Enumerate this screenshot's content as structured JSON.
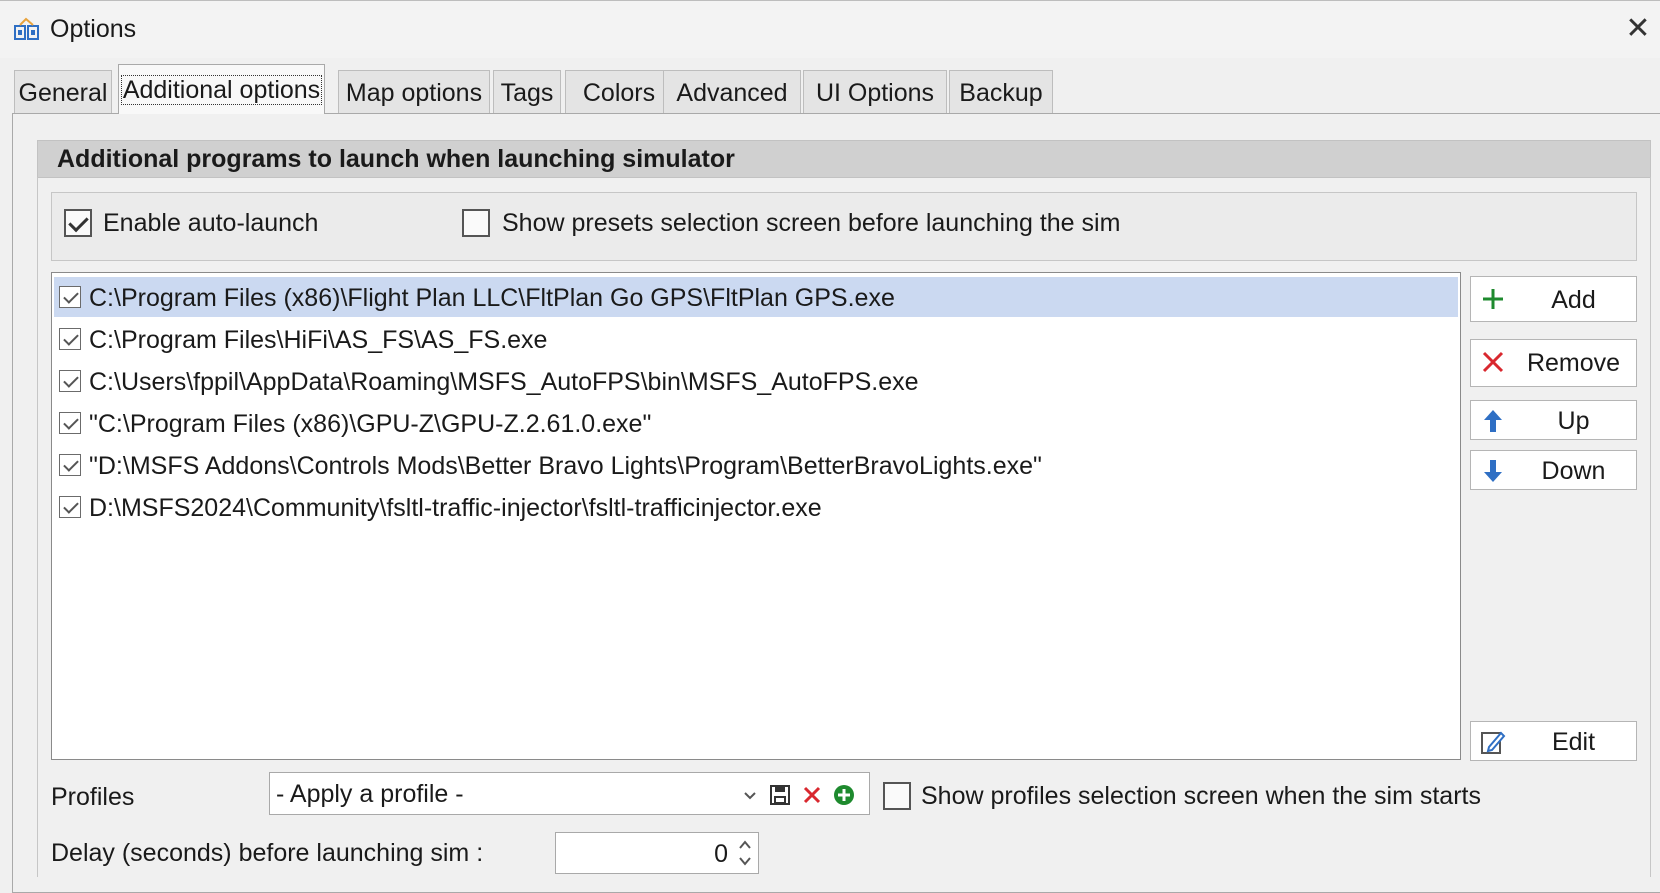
{
  "window": {
    "title": "Options",
    "icon": "options-window-icon",
    "close_glyph": "✕"
  },
  "tabs": [
    {
      "label": "General"
    },
    {
      "label": "Additional options",
      "active": true
    },
    {
      "label": "Map options"
    },
    {
      "label": "Tags"
    },
    {
      "label": "Colors"
    },
    {
      "label": "Advanced"
    },
    {
      "label": "UI Options"
    },
    {
      "label": "Backup"
    }
  ],
  "group": {
    "header": "Additional programs to launch when launching simulator",
    "enable_autolaunch": {
      "label": "Enable auto-launch",
      "checked": true
    },
    "show_presets": {
      "label": "Show presets selection screen before launching the sim",
      "checked": false
    }
  },
  "programs": [
    {
      "path": "C:\\Program Files (x86)\\Flight Plan LLC\\FltPlan Go GPS\\FltPlan GPS.exe",
      "checked": true,
      "selected": true
    },
    {
      "path": "C:\\Program Files\\HiFi\\AS_FS\\AS_FS.exe",
      "checked": true
    },
    {
      "path": "C:\\Users\\fppil\\AppData\\Roaming\\MSFS_AutoFPS\\bin\\MSFS_AutoFPS.exe",
      "checked": true
    },
    {
      "path": "\"C:\\Program Files (x86)\\GPU-Z\\GPU-Z.2.61.0.exe\"",
      "checked": true
    },
    {
      "path": "\"D:\\MSFS Addons\\Controls Mods\\Better Bravo Lights\\Program\\BetterBravoLights.exe\"",
      "checked": true
    },
    {
      "path": "D:\\MSFS2024\\Community\\fsltl-traffic-injector\\fsltl-trafficinjector.exe",
      "checked": true
    }
  ],
  "buttons": {
    "add": {
      "label": "Add",
      "icon": "plus-icon",
      "color": "#1e8a2e"
    },
    "remove": {
      "label": "Remove",
      "icon": "x-icon",
      "color": "#d9282f"
    },
    "up": {
      "label": "Up",
      "icon": "arrow-up-icon",
      "color": "#2f6fc4"
    },
    "down": {
      "label": "Down",
      "icon": "arrow-down-icon",
      "color": "#2f6fc4"
    },
    "edit": {
      "label": "Edit",
      "icon": "edit-icon"
    }
  },
  "profiles": {
    "label": "Profiles",
    "combo_value": "- Apply a profile -",
    "show_profiles": {
      "label": "Show profiles selection screen when the sim starts",
      "checked": false
    }
  },
  "delay": {
    "label": "Delay (seconds) before launching sim :",
    "value": "0"
  },
  "colors": {
    "selection": "#cbd9f1",
    "group_header_bg": "#d0d0d0",
    "window_bg": "#f0f0f0"
  }
}
